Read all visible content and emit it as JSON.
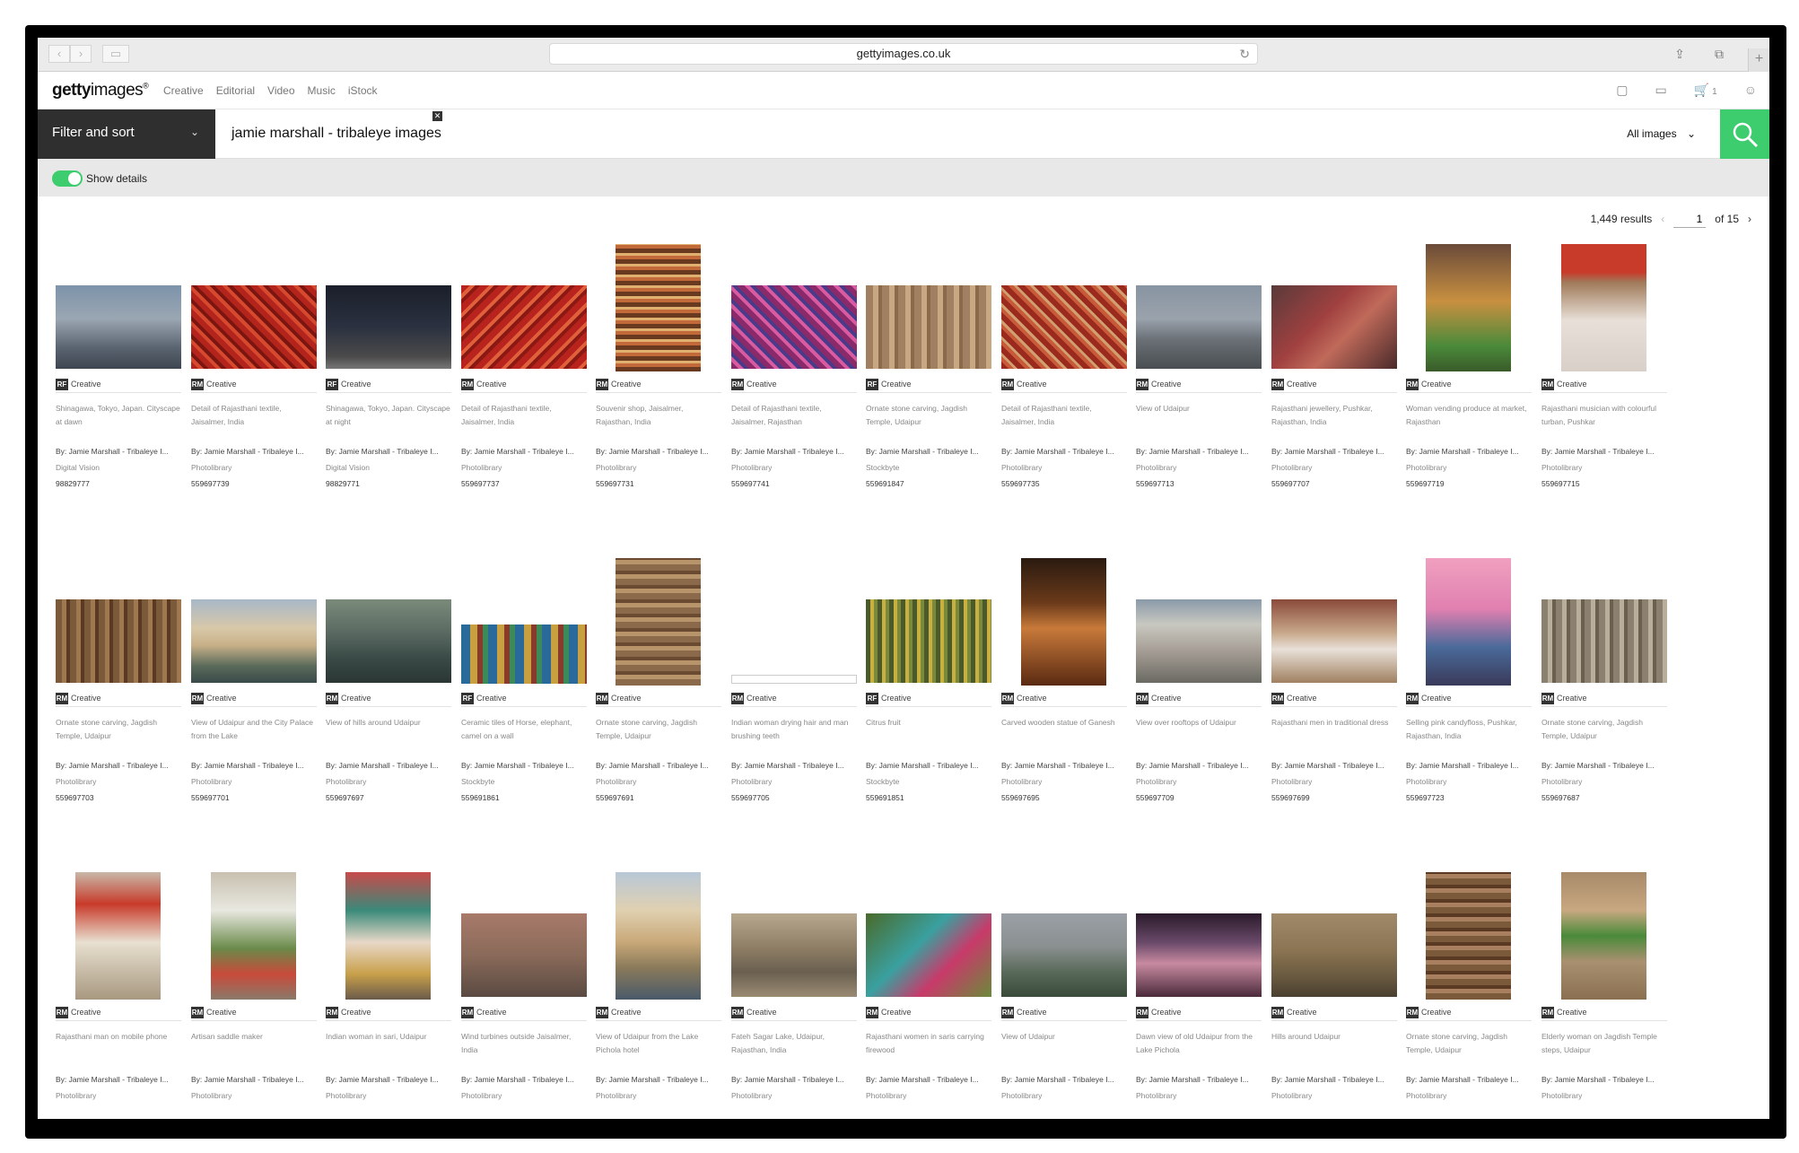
{
  "browser": {
    "url": "gettyimages.co.uk",
    "back": "‹",
    "forward": "›",
    "sidebar": "▭",
    "reload": "↻",
    "share": "⇪",
    "tabs": "⧉",
    "new_tab": "+"
  },
  "header": {
    "logo_bold": "getty",
    "logo_rest": "images",
    "logo_mark": "®",
    "nav": [
      "Creative",
      "Editorial",
      "Video",
      "Music",
      "iStock"
    ],
    "cart_count": "1"
  },
  "search": {
    "filter_label": "Filter and sort",
    "query": "jamie marshall - tribaleye images",
    "scope": "All images"
  },
  "details": {
    "label": "Show details"
  },
  "results": {
    "count": "1,449 results",
    "page": "1",
    "of": "of 15"
  },
  "colors": {
    "accent": "#3dcc6e",
    "dark": "#2f2f2f"
  },
  "rows": [
    [
      {
        "shape": "land",
        "bg": "linear-gradient(180deg,#7d93aa 0%,#9aa6b2 40%,#5a6470 75%,#3d4650 100%)",
        "lic": "RF",
        "caption": "Shinagawa, Tokyo, Japan. Cityscape at dawn",
        "by": "By: Jamie Marshall - Tribaleye I...",
        "coll": "Digital Vision",
        "id": "98829777"
      },
      {
        "shape": "land",
        "bg": "repeating-linear-gradient(45deg,#b3241c 0 6px,#d6492e 6px 10px,#7a1510 10px 14px)",
        "lic": "RM",
        "caption": "Detail of Rajasthani textile, Jaisalmer, India",
        "by": "By: Jamie Marshall - Tribaleye I...",
        "coll": "Photolibrary",
        "id": "559697739"
      },
      {
        "shape": "land",
        "bg": "linear-gradient(180deg,#1a1f2a 0%,#2b3140 50%,#4a4a4a 85%,#777 100%)",
        "lic": "RF",
        "caption": "Shinagawa, Tokyo, Japan. Cityscape at night",
        "by": "By: Jamie Marshall - Tribaleye I...",
        "coll": "Digital Vision",
        "id": "98829771"
      },
      {
        "shape": "land",
        "bg": "repeating-linear-gradient(135deg,#b8231e 0 7px,#e0603c 7px 11px,#8a1813 11px 15px)",
        "lic": "RM",
        "caption": "Detail of Rajasthani textile, Jaisalmer, India",
        "by": "By: Jamie Marshall - Tribaleye I...",
        "coll": "Photolibrary",
        "id": "559697737"
      },
      {
        "shape": "port",
        "bg": "repeating-linear-gradient(0deg,#6a3a20 0 5px,#c26a3a 5px 9px,#e0b070 9px 12px)",
        "lic": "RM",
        "caption": "Souvenir shop, Jaisalmer, Rajasthan, India",
        "by": "By: Jamie Marshall - Tribaleye I...",
        "coll": "Photolibrary",
        "id": "559697731"
      },
      {
        "shape": "land",
        "bg": "repeating-linear-gradient(45deg,#8a2a6a 0 6px,#d85aa0 6px 10px,#4a3a8a 10px 14px)",
        "lic": "RM",
        "caption": "Detail of Rajasthani textile, Jaisalmer, Rajasthan",
        "by": "By: Jamie Marshall - Tribaleye I...",
        "coll": "Photolibrary",
        "id": "559697741"
      },
      {
        "shape": "land",
        "bg": "repeating-linear-gradient(90deg,#a08060 0 8px,#c8a882 8px 14px,#8a6a4a 14px 18px)",
        "lic": "RF",
        "caption": "Ornate stone carving, Jagdish Temple, Udaipur",
        "by": "By: Jamie Marshall - Tribaleye I...",
        "coll": "Stockbyte",
        "id": "559691847"
      },
      {
        "shape": "land",
        "bg": "repeating-linear-gradient(45deg,#9a2a1e 0 6px,#c85a3a 6px 10px,#d0a070 10px 13px)",
        "lic": "RM",
        "caption": "Detail of Rajasthani textile, Jaisalmer, India",
        "by": "By: Jamie Marshall - Tribaleye I...",
        "coll": "Photolibrary",
        "id": "559697735"
      },
      {
        "shape": "land",
        "bg": "linear-gradient(180deg,#8894a2 0%,#9aa2ac 40%,#6a7076 65%,#4a4e52 100%)",
        "lic": "RM",
        "caption": "View of Udaipur",
        "by": "By: Jamie Marshall - Tribaleye I...",
        "coll": "Photolibrary",
        "id": "559697713"
      },
      {
        "shape": "land",
        "bg": "linear-gradient(135deg,#5a3a3a 0%,#a04040 40%,#c06a5a 60%,#4a2a2a 100%)",
        "lic": "RM",
        "caption": "Rajasthani jewellery, Pushkar, Rajasthan, India",
        "by": "By: Jamie Marshall - Tribaleye I...",
        "coll": "Photolibrary",
        "id": "559697707"
      },
      {
        "shape": "port",
        "bg": "linear-gradient(180deg,#6a4a3a 0%,#c89040 45%,#4a8a3a 80%,#3a5a2a 100%)",
        "lic": "RM",
        "caption": "Woman vending produce at market, Rajasthan",
        "by": "By: Jamie Marshall - Tribaleye I...",
        "coll": "Photolibrary",
        "id": "559697719"
      },
      {
        "shape": "port",
        "bg": "linear-gradient(180deg,#c83a2a 0%,#c83a2a 22%,#a07a5a 30%,#e8e0d8 60%,#d8d0c8 100%)",
        "lic": "RM",
        "caption": "Rajasthani musician with colourful turban, Pushkar",
        "by": "By: Jamie Marshall - Tribaleye I...",
        "coll": "Photolibrary",
        "id": "559697715"
      }
    ],
    [
      {
        "shape": "land",
        "bg": "repeating-linear-gradient(90deg,#7a5a3a 0 7px,#a07850 7px 12px,#5a3a22 12px 16px)",
        "lic": "RM",
        "caption": "Ornate stone carving, Jagdish Temple, Udaipur",
        "by": "By: Jamie Marshall - Tribaleye I...",
        "coll": "Photolibrary",
        "id": "559697703"
      },
      {
        "shape": "land",
        "bg": "linear-gradient(180deg,#a8b8c8 0%,#d8c8a8 35%,#c8b088 55%,#5a6a5a 80%,#3a4a4a 100%)",
        "lic": "RM",
        "caption": "View of Udaipur and the City Palace from the Lake",
        "by": "By: Jamie Marshall - Tribaleye I...",
        "coll": "Photolibrary",
        "id": "559697701"
      },
      {
        "shape": "land",
        "bg": "linear-gradient(180deg,#7a8a7a 0%,#5a6a62 40%,#3a4a46 70%,#2a3634 100%)",
        "lic": "RM",
        "caption": "View of hills around Udaipur",
        "by": "By: Jamie Marshall - Tribaleye I...",
        "coll": "Photolibrary",
        "id": "559697697"
      },
      {
        "shape": "wide",
        "bg": "repeating-linear-gradient(90deg,#2a6a9a 0 10px,#c8a040 10px 18px,#8a3a2a 18px 24px,#3a8a5a 24px 30px)",
        "lic": "RF",
        "caption": "Ceramic tiles of Horse, elephant, camel on a wall",
        "by": "By: Jamie Marshall - Tribaleye I...",
        "coll": "Stockbyte",
        "id": "559691861"
      },
      {
        "shape": "port",
        "bg": "repeating-linear-gradient(0deg,#8a6a4a 0 7px,#b8946a 7px 12px,#6a4a30 12px 16px)",
        "lic": "RM",
        "caption": "Ornate stone carving, Jagdish Temple, Udaipur",
        "by": "By: Jamie Marshall - Tribaleye I...",
        "coll": "Photolibrary",
        "id": "559697691"
      },
      {
        "shape": "thin",
        "bg": "#ffffff",
        "lic": "RM",
        "caption": "Indian woman drying hair and man brushing teeth",
        "by": "By: Jamie Marshall - Tribaleye I...",
        "coll": "Photolibrary",
        "id": "559697705"
      },
      {
        "shape": "land",
        "bg": "repeating-linear-gradient(90deg,#4a5a2a 0 5px,#c8b040 5px 9px,#7a8a3a 9px 13px)",
        "lic": "RF",
        "caption": "Citrus fruit",
        "by": "By: Jamie Marshall - Tribaleye I...",
        "coll": "Stockbyte",
        "id": "559691851"
      },
      {
        "shape": "port",
        "bg": "linear-gradient(180deg,#2a1a10 0%,#6a3a1a 35%,#c87a3a 55%,#5a2a12 100%)",
        "lic": "RM",
        "caption": "Carved wooden statue of Ganesh",
        "by": "By: Jamie Marshall - Tribaleye I...",
        "coll": "Photolibrary",
        "id": "559697695"
      },
      {
        "shape": "land",
        "bg": "linear-gradient(180deg,#8a9aaa 0%,#c8c8c0 30%,#a8a098 60%,#6a6a62 100%)",
        "lic": "RM",
        "caption": "View over rooftops of Udaipur",
        "by": "By: Jamie Marshall - Tribaleye I...",
        "coll": "Photolibrary",
        "id": "559697709"
      },
      {
        "shape": "land",
        "bg": "linear-gradient(180deg,#8a4a3a 0%,#c8a88a 40%,#e8e0d8 60%,#a08060 100%)",
        "lic": "RM",
        "caption": "Rajasthani men in traditional dress",
        "by": "By: Jamie Marshall - Tribaleye I...",
        "coll": "Photolibrary",
        "id": "559697699"
      },
      {
        "shape": "port",
        "bg": "linear-gradient(180deg,#f0a0c0 0%,#e080b0 40%,#4a6a9a 70%,#3a3a5a 100%)",
        "lic": "RM",
        "caption": "Selling pink candyfloss, Pushkar, Rajasthan, India",
        "by": "By: Jamie Marshall - Tribaleye I...",
        "coll": "Photolibrary",
        "id": "559697723"
      },
      {
        "shape": "land",
        "bg": "repeating-linear-gradient(90deg,#8a8070 0 7px,#b8ae9a 7px 12px,#6a6050 12px 16px)",
        "lic": "RM",
        "caption": "Ornate stone carving, Jagdish Temple, Udaipur",
        "by": "By: Jamie Marshall - Tribaleye I...",
        "coll": "Photolibrary",
        "id": "559697687"
      }
    ],
    [
      {
        "shape": "port",
        "bg": "linear-gradient(180deg,#c8b8a8 0%,#c83a2a 25%,#e8e0d0 55%,#a89880 100%)",
        "lic": "RM",
        "caption": "Rajasthani man on mobile phone",
        "by": "By: Jamie Marshall - Tribaleye I...",
        "coll": "Photolibrary",
        "id": ""
      },
      {
        "shape": "port",
        "bg": "linear-gradient(180deg,#c8c0b0 0%,#e8e8e0 30%,#6a8a4a 60%,#c84a3a 80%,#8a7a6a 100%)",
        "lic": "RM",
        "caption": "Artisan saddle maker",
        "by": "By: Jamie Marshall - Tribaleye I...",
        "coll": "Photolibrary",
        "id": ""
      },
      {
        "shape": "port",
        "bg": "linear-gradient(180deg,#c84a4a 0%,#3a8a7a 30%,#e8d8c8 55%,#c8a04a 80%,#6a5a4a 100%)",
        "lic": "RM",
        "caption": "Indian woman in sari, Udaipur",
        "by": "By: Jamie Marshall - Tribaleye I...",
        "coll": "Photolibrary",
        "id": ""
      },
      {
        "shape": "land",
        "bg": "linear-gradient(180deg,#a87a6a 0%,#8a6a5a 50%,#5a4a42 100%)",
        "lic": "RM",
        "caption": "Wind turbines outside Jaisalmer, India",
        "by": "By: Jamie Marshall - Tribaleye I...",
        "coll": "Photolibrary",
        "id": ""
      },
      {
        "shape": "port",
        "bg": "linear-gradient(180deg,#b8c8d8 0%,#e0d0b0 30%,#c8a878 55%,#8a7a5a 75%,#4a5a6a 100%)",
        "lic": "RM",
        "caption": "View of Udaipur from the Lake Pichola hotel",
        "by": "By: Jamie Marshall - Tribaleye I...",
        "coll": "Photolibrary",
        "id": ""
      },
      {
        "shape": "land",
        "bg": "linear-gradient(180deg,#b8a890 0%,#8a7a62 45%,#6a6050 70%,#9a8a72 100%)",
        "lic": "RM",
        "caption": "Fateh Sagar Lake, Udaipur, Rajasthan, India",
        "by": "By: Jamie Marshall - Tribaleye I...",
        "coll": "Photolibrary",
        "id": ""
      },
      {
        "shape": "land",
        "bg": "linear-gradient(135deg,#4a6a2a 0%,#3aa0a0 40%,#c83a6a 65%,#6a8a3a 100%)",
        "lic": "RM",
        "caption": "Rajasthani women in saris carrying firewood",
        "by": "By: Jamie Marshall - Tribaleye I...",
        "coll": "Photolibrary",
        "id": ""
      },
      {
        "shape": "land",
        "bg": "linear-gradient(180deg,#9aa0a6 0%,#8a9090 40%,#5a6a5a 70%,#3a4a3a 100%)",
        "lic": "RM",
        "caption": "View of Udaipur",
        "by": "By: Jamie Marshall - Tribaleye I...",
        "coll": "Photolibrary",
        "id": ""
      },
      {
        "shape": "land",
        "bg": "linear-gradient(180deg,#2a1a2a 0%,#6a4a6a 35%,#c88aa0 60%,#4a2a3a 100%)",
        "lic": "RM",
        "caption": "Dawn view of old Udaipur from the Lake Pichola",
        "by": "By: Jamie Marshall - Tribaleye I...",
        "coll": "Photolibrary",
        "id": ""
      },
      {
        "shape": "land",
        "bg": "linear-gradient(180deg,#a08a6a 0%,#8a7452 45%,#6a5a40 75%,#4a4030 100%)",
        "lic": "RM",
        "caption": "Hills around Udaipur",
        "by": "By: Jamie Marshall - Tribaleye I...",
        "coll": "Photolibrary",
        "id": ""
      },
      {
        "shape": "port",
        "bg": "repeating-linear-gradient(0deg,#7a5a3a 0 7px,#a88060 7px 12px,#5a3a22 12px 16px)",
        "lic": "RM",
        "caption": "Ornate stone carving, Jagdish Temple, Udaipur",
        "by": "By: Jamie Marshall - Tribaleye I...",
        "coll": "Photolibrary",
        "id": ""
      },
      {
        "shape": "port",
        "bg": "linear-gradient(180deg,#a88a6a 0%,#c8a880 30%,#4a8a3a 50%,#a89070 70%,#8a7050 100%)",
        "lic": "RM",
        "caption": "Elderly woman on Jagdish Temple steps, Udaipur",
        "by": "By: Jamie Marshall - Tribaleye I...",
        "coll": "Photolibrary",
        "id": ""
      }
    ]
  ],
  "license_label": "Creative"
}
